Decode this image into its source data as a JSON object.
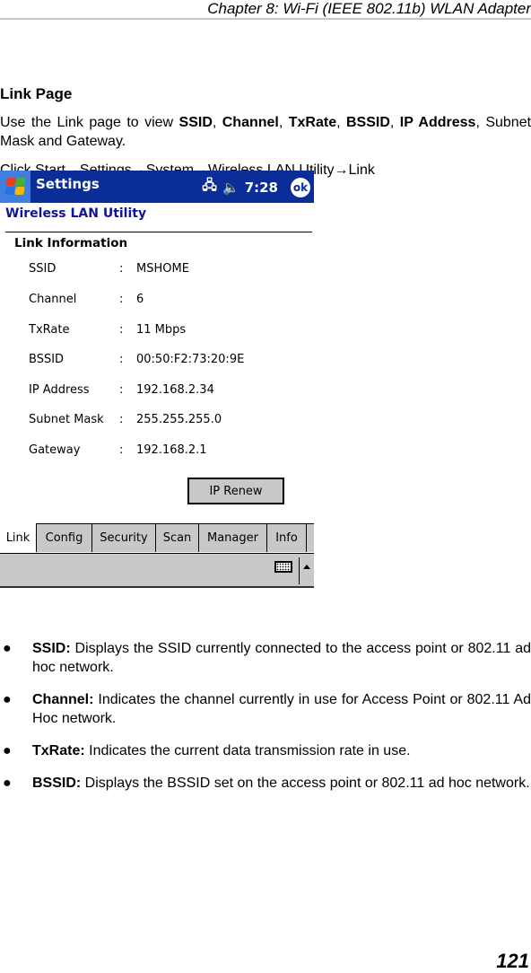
{
  "header": {
    "chapter": "Chapter 8: Wi-Fi (IEEE 802.11b) WLAN Adapter"
  },
  "section": {
    "title": "Link Page",
    "intro_prefix": "Use the Link page to view ",
    "intro_terms": [
      "SSID",
      "Channel",
      "TxRate",
      "BSSID",
      "IP Address"
    ],
    "intro_sep": ", ",
    "intro_suffix": "Subnet Mask and Gateway.",
    "nav_path": "Click Start→Settings→System→Wireless LAN Utility→Link"
  },
  "screenshot": {
    "title_bar": {
      "title": "Settings",
      "time": "7:28",
      "ok_label": "ok",
      "colors": {
        "bar": "#0a2d98",
        "start": "#3e7fe0"
      }
    },
    "app_title": "Wireless LAN Utility",
    "group_title": "Link Information",
    "rows": [
      {
        "label": "SSID",
        "value": "MSHOME"
      },
      {
        "label": "Channel",
        "value": "6"
      },
      {
        "label": "TxRate",
        "value": "11 Mbps"
      },
      {
        "label": "BSSID",
        "value": "00:50:F2:73:20:9E"
      },
      {
        "label": "IP Address",
        "value": "192.168.2.34"
      },
      {
        "label": "Subnet Mask",
        "value": "255.255.255.0"
      },
      {
        "label": "Gateway",
        "value": "192.168.2.1"
      }
    ],
    "colon": ":",
    "renew_button": "IP Renew",
    "tabs": [
      {
        "label": "Link",
        "active": true
      },
      {
        "label": "Config",
        "active": false
      },
      {
        "label": "Security",
        "active": false
      },
      {
        "label": "Scan",
        "active": false
      },
      {
        "label": "Manager",
        "active": false
      },
      {
        "label": "Info",
        "active": false
      }
    ]
  },
  "bullets": [
    {
      "term": "SSID:",
      "text": " Displays the SSID currently connected to the access point or 802.11 ad hoc network."
    },
    {
      "term": "Channel:",
      "text": " Indicates the channel currently in use for Access Point or 802.11 Ad Hoc network."
    },
    {
      "term": "TxRate:",
      "text": " Indicates the current data transmission rate in use."
    },
    {
      "term": "BSSID:",
      "text": " Displays the BSSID set on the access point or 802.11 ad hoc network."
    }
  ],
  "page_number": "121"
}
